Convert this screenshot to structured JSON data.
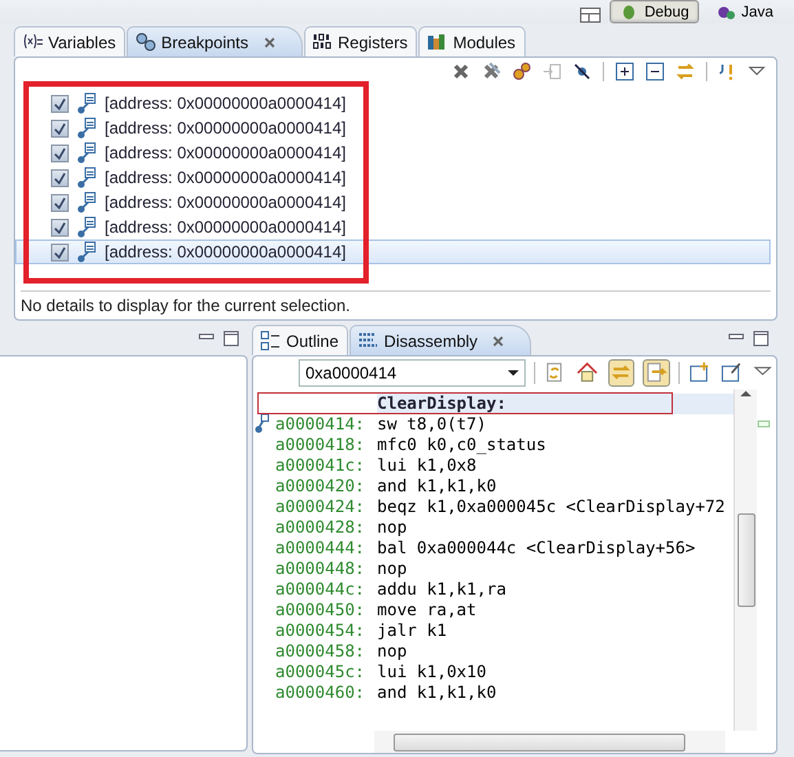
{
  "perspectives": [
    {
      "label": "Debug",
      "selected": true
    },
    {
      "label": "Java",
      "selected": false
    }
  ],
  "breakpoints_view": {
    "tabs": [
      {
        "label": "Variables",
        "selected": false,
        "kind": "variables"
      },
      {
        "label": "Breakpoints",
        "selected": true,
        "kind": "breakpoints"
      },
      {
        "label": "Registers",
        "selected": false,
        "kind": "registers"
      },
      {
        "label": "Modules",
        "selected": false,
        "kind": "modules"
      }
    ],
    "breakpoints": [
      {
        "label": "[address: 0x00000000a0000414]",
        "checked": true,
        "selected": false
      },
      {
        "label": "[address: 0x00000000a0000414]",
        "checked": true,
        "selected": false
      },
      {
        "label": "[address: 0x00000000a0000414]",
        "checked": true,
        "selected": false
      },
      {
        "label": "[address: 0x00000000a0000414]",
        "checked": true,
        "selected": false
      },
      {
        "label": "[address: 0x00000000a0000414]",
        "checked": true,
        "selected": false
      },
      {
        "label": "[address: 0x00000000a0000414]",
        "checked": true,
        "selected": false
      },
      {
        "label": "[address: 0x00000000a0000414]",
        "checked": true,
        "selected": true
      }
    ],
    "details": "No details to display for the current selection."
  },
  "disassembly_view": {
    "tabs": [
      {
        "label": "Outline",
        "selected": false,
        "kind": "outline"
      },
      {
        "label": "Disassembly",
        "selected": true,
        "kind": "disassembly"
      }
    ],
    "address": "0xa0000414",
    "function_label": "ClearDisplay:",
    "lines": [
      {
        "address": "a0000414:",
        "instruction": "sw t8,0(t7)",
        "breakpoint": true
      },
      {
        "address": "a0000418:",
        "instruction": "mfc0 k0,c0_status",
        "breakpoint": false
      },
      {
        "address": "a000041c:",
        "instruction": "lui k1,0x8",
        "breakpoint": false
      },
      {
        "address": "a0000420:",
        "instruction": "and k1,k1,k0",
        "breakpoint": false
      },
      {
        "address": "a0000424:",
        "instruction": "beqz k1,0xa000045c <ClearDisplay+72",
        "breakpoint": false
      },
      {
        "address": "a0000428:",
        "instruction": "nop",
        "breakpoint": false
      },
      {
        "address": "a0000444:",
        "instruction": "bal 0xa000044c <ClearDisplay+56>",
        "breakpoint": false
      },
      {
        "address": "a0000448:",
        "instruction": "nop",
        "breakpoint": false
      },
      {
        "address": "a000044c:",
        "instruction": "addu k1,k1,ra",
        "breakpoint": false
      },
      {
        "address": "a0000450:",
        "instruction": "move ra,at",
        "breakpoint": false
      },
      {
        "address": "a0000454:",
        "instruction": "jalr k1",
        "breakpoint": false
      },
      {
        "address": "a0000458:",
        "instruction": "nop",
        "breakpoint": false
      },
      {
        "address": "a000045c:",
        "instruction": "lui k1,0x10",
        "breakpoint": false
      },
      {
        "address": "a0000460:",
        "instruction": "and k1,k1,k0",
        "breakpoint": false
      }
    ]
  }
}
